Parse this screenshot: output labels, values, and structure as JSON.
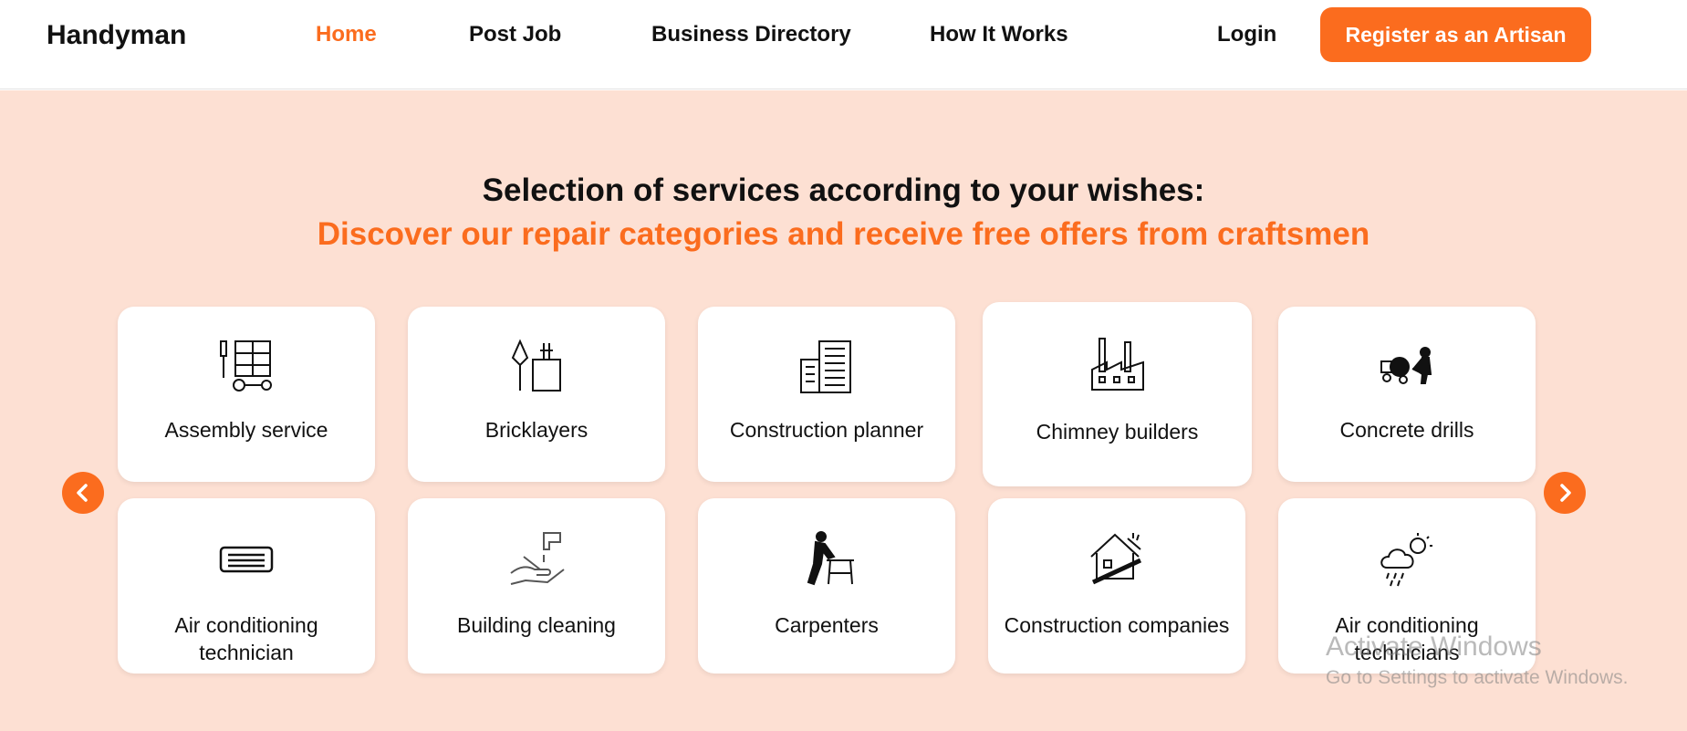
{
  "nav": {
    "brand": "Handyman",
    "links": [
      {
        "label": "Home",
        "active": true
      },
      {
        "label": "Post Job",
        "active": false
      },
      {
        "label": "Business Directory",
        "active": false
      },
      {
        "label": "How It Works",
        "active": false
      }
    ],
    "login": "Login",
    "register": "Register as an Artisan"
  },
  "hero": {
    "heading": "Selection of services according to your wishes:",
    "subheading": "Discover our repair categories and receive free offers from craftsmen"
  },
  "services": [
    {
      "label": "Assembly service",
      "icon": "tools-cabinet-icon"
    },
    {
      "label": "Bricklayers",
      "icon": "trowel-icon"
    },
    {
      "label": "Construction planner",
      "icon": "buildings-icon"
    },
    {
      "label": "Chimney builders",
      "icon": "factory-chimney-icon"
    },
    {
      "label": "Concrete drills",
      "icon": "concrete-mixer-icon"
    },
    {
      "label": "Air conditioning technician",
      "icon": "air-conditioner-icon"
    },
    {
      "label": "Building cleaning",
      "icon": "hand-wash-icon"
    },
    {
      "label": "Carpenters",
      "icon": "carpenter-icon"
    },
    {
      "label": "Construction companies",
      "icon": "house-hammer-icon"
    },
    {
      "label": "Air conditioning technicians",
      "icon": "weather-cloud-icon"
    }
  ],
  "carousel": {
    "prev_icon": "chevron-left-icon",
    "next_icon": "chevron-right-icon"
  },
  "watermark": {
    "line1": "Activate Windows",
    "line2": "Go to Settings to activate Windows."
  },
  "colors": {
    "accent": "#fb6c1e",
    "hero_bg": "#fde0d3"
  }
}
